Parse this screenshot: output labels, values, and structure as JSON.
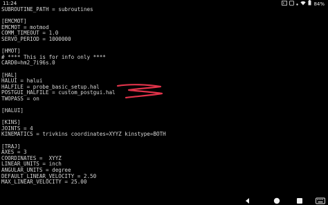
{
  "status_bar": {
    "time": "11:24",
    "battery_percent": "84%",
    "icons": [
      "terminal-icon",
      "notification-icon",
      "dot-icon",
      "wifi-icon",
      "battery-icon"
    ]
  },
  "editor": {
    "lines": [
      "SUBROUTINE_PATH = subroutines",
      "",
      "[EMCMOT]",
      "EMCMOT = motmod",
      "COMM_TIMEOUT = 1.0",
      "SERVO_PERIOD = 1000000",
      "",
      "[HMOT]",
      "# **** This is for info only ****",
      "CARD0=hm2_7i96s.0",
      "",
      "[HAL]",
      "HALUI = halui",
      "HALFILE = probe_basic_setup.hal",
      "POSTGUI_HALFILE = custom_postgui.hal",
      "TWOPASS = on",
      "",
      "[HALUI]",
      "",
      "[KINS]",
      "JOINTS = 4",
      "KINEMATICS = trivkins coordinates=XYYZ kinstype=BOTH",
      "",
      "[TRAJ]",
      "AXES = 3",
      "COORDINATES =  XYYZ",
      "LINEAR_UNITS = inch",
      "ANGULAR_UNITS = degree",
      "DEFAULT_LINEAR_VELOCITY = 2.50",
      "MAX_LINEAR_VELOCITY = 25.00"
    ]
  },
  "annotation": {
    "color": "#e0334a"
  },
  "nav_bar": {
    "buttons": [
      "back-button",
      "home-button",
      "recents-button",
      "keyboard-button"
    ]
  },
  "colors": {
    "background": "#000000",
    "text": "#d8d8d8",
    "status_text": "#e8e8e8"
  }
}
